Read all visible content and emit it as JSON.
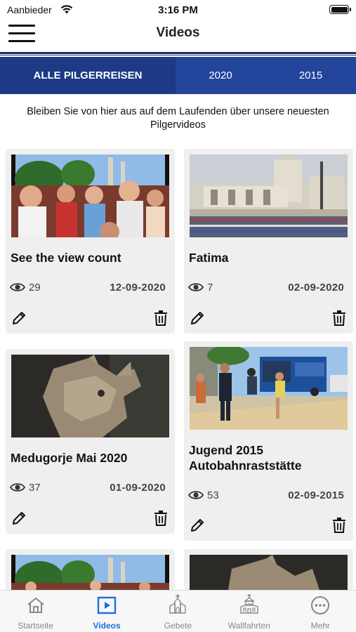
{
  "status": {
    "carrier": "Aanbieder",
    "time": "3:16 PM"
  },
  "nav": {
    "title": "Videos"
  },
  "tabs": [
    {
      "label": "ALLE PILGERREISEN"
    },
    {
      "label": "2020"
    },
    {
      "label": "2015"
    }
  ],
  "intro": "Bleiben Sie von hier aus auf dem Laufenden über unsere neuesten Pilgervideos",
  "videos": [
    {
      "title": "See the view count",
      "views": "29",
      "date": "12-09-2020",
      "thumb_icon": "crowd-photo"
    },
    {
      "title": "Fatima",
      "views": "7",
      "date": "02-09-2020",
      "thumb_icon": "basilica-photo"
    },
    {
      "title": "Medugorje Mai 2020",
      "views": "37",
      "date": "01-09-2020",
      "thumb_icon": "sculpture-photo"
    },
    {
      "title": "Jugend 2015 Autobahnraststätte",
      "views": "53",
      "date": "02-09-2015",
      "thumb_icon": "bus-photo"
    }
  ],
  "bottom_tabs": [
    {
      "label": "Startseite",
      "icon": "home-icon"
    },
    {
      "label": "Videos",
      "icon": "video-icon"
    },
    {
      "label": "Gebete",
      "icon": "church-icon"
    },
    {
      "label": "Wallfahrten",
      "icon": "chapel-icon"
    },
    {
      "label": "Mehr",
      "icon": "more-icon"
    }
  ],
  "colors": {
    "primary": "#22449a",
    "primary_dark": "#1c3a85",
    "active_tab": "#1a6fdc",
    "card_bg": "#efefef"
  }
}
